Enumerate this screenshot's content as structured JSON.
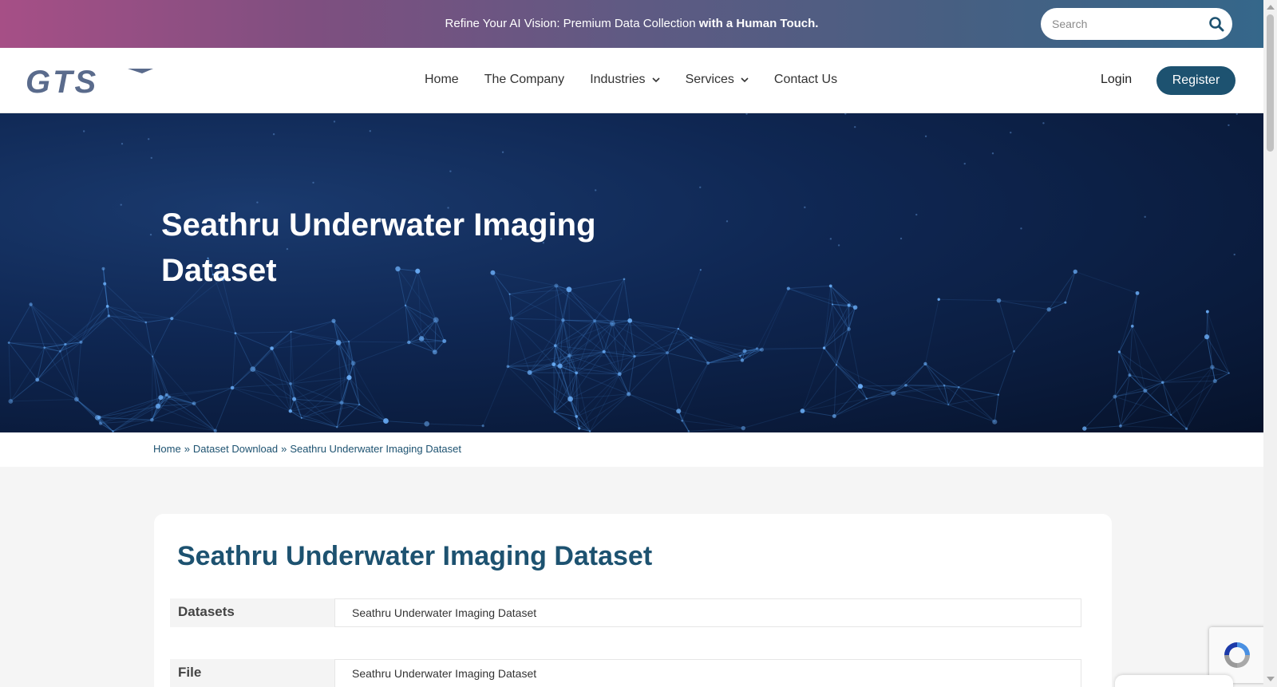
{
  "topbar": {
    "promo_text": "Refine Your AI Vision: Premium Data Collection ",
    "promo_bold": "with a Human Touch.",
    "search_placeholder": "Search",
    "gradient_start": "#a64f86",
    "gradient_end": "#35678a"
  },
  "nav": {
    "logo_text": "GTS",
    "items": [
      {
        "label": "Home",
        "has_dropdown": false
      },
      {
        "label": "The Company",
        "has_dropdown": false
      },
      {
        "label": "Industries",
        "has_dropdown": true
      },
      {
        "label": "Services",
        "has_dropdown": true
      },
      {
        "label": "Contact Us",
        "has_dropdown": false
      }
    ],
    "login_label": "Login",
    "register_label": "Register",
    "accent_color": "#1d5270"
  },
  "hero": {
    "title": "Seathru Underwater Imaging Dataset"
  },
  "breadcrumb": {
    "items": [
      "Home",
      "Dataset Download",
      "Seathru Underwater Imaging Dataset"
    ],
    "separator": "»"
  },
  "content": {
    "title": "Seathru Underwater Imaging Dataset",
    "rows": [
      {
        "label": "Datasets",
        "value": "Seathru Underwater Imaging Dataset"
      },
      {
        "label": "File",
        "value": "Seathru Underwater Imaging Dataset"
      }
    ]
  },
  "icons": {
    "search": "search-icon",
    "chevron": "chevron-down-icon",
    "recaptcha": "recaptcha-icon"
  }
}
